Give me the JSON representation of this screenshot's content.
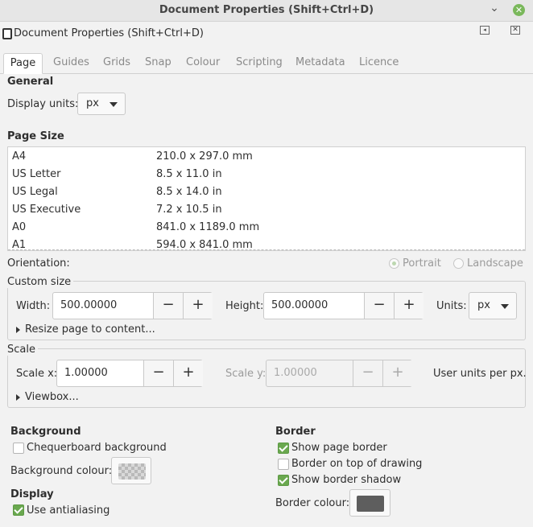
{
  "window": {
    "title": "Document Properties (Shift+Ctrl+D)",
    "dock_title": "Document Properties (Shift+Ctrl+D)",
    "close_icon": "close-icon",
    "minimize_icon": "minimize-icon"
  },
  "tabs": [
    {
      "label": "Page",
      "active": true
    },
    {
      "label": "Guides"
    },
    {
      "label": "Grids"
    },
    {
      "label": "Snap"
    },
    {
      "label": "Colour"
    },
    {
      "label": "Scripting"
    },
    {
      "label": "Metadata"
    },
    {
      "label": "Licence"
    }
  ],
  "general": {
    "heading": "General",
    "display_units_label": "Display units:",
    "display_units_value": "px"
  },
  "page_size": {
    "heading": "Page Size",
    "rows": [
      {
        "name": "A4",
        "size": "210.0 x 297.0 mm"
      },
      {
        "name": "US Letter",
        "size": "8.5 x 11.0 in"
      },
      {
        "name": "US Legal",
        "size": "8.5 x 14.0 in"
      },
      {
        "name": "US Executive",
        "size": "7.2 x 10.5 in"
      },
      {
        "name": "A0",
        "size": "841.0 x 1189.0 mm"
      },
      {
        "name": "A1",
        "size": "594.0 x 841.0 mm"
      }
    ]
  },
  "orientation": {
    "label": "Orientation:",
    "portrait": "Portrait",
    "landscape": "Landscape",
    "selected": "portrait"
  },
  "custom_size": {
    "heading": "Custom size",
    "width_label": "Width:",
    "width_value": "500.00000",
    "height_label": "Height:",
    "height_value": "500.00000",
    "units_label": "Units:",
    "units_value": "px",
    "resize_label": "Resize page to content..."
  },
  "scale": {
    "heading": "Scale",
    "scale_x_label": "Scale x:",
    "scale_x_value": "1.00000",
    "scale_y_label": "Scale y:",
    "scale_y_value": "1.00000",
    "user_units_label": "User units per px.",
    "viewbox_label": "Viewbox..."
  },
  "background": {
    "heading": "Background",
    "checkerboard_label": "Chequerboard background",
    "checkerboard_checked": false,
    "colour_label": "Background colour:"
  },
  "display": {
    "heading": "Display",
    "antialias_label": "Use antialiasing",
    "antialias_checked": true
  },
  "border": {
    "heading": "Border",
    "show_border_label": "Show page border",
    "show_border_checked": true,
    "border_on_top_label": "Border on top of drawing",
    "border_on_top_checked": false,
    "show_shadow_label": "Show border shadow",
    "show_shadow_checked": true,
    "colour_label": "Border colour:",
    "colour": "#5e5e5e"
  },
  "colors": {
    "accent": "#6aa84f",
    "window_bg": "#f2f2f2"
  },
  "symbols": {
    "minus": "−",
    "plus": "+",
    "close": "✕",
    "minimize": "◂",
    "tb_close": "✕"
  }
}
